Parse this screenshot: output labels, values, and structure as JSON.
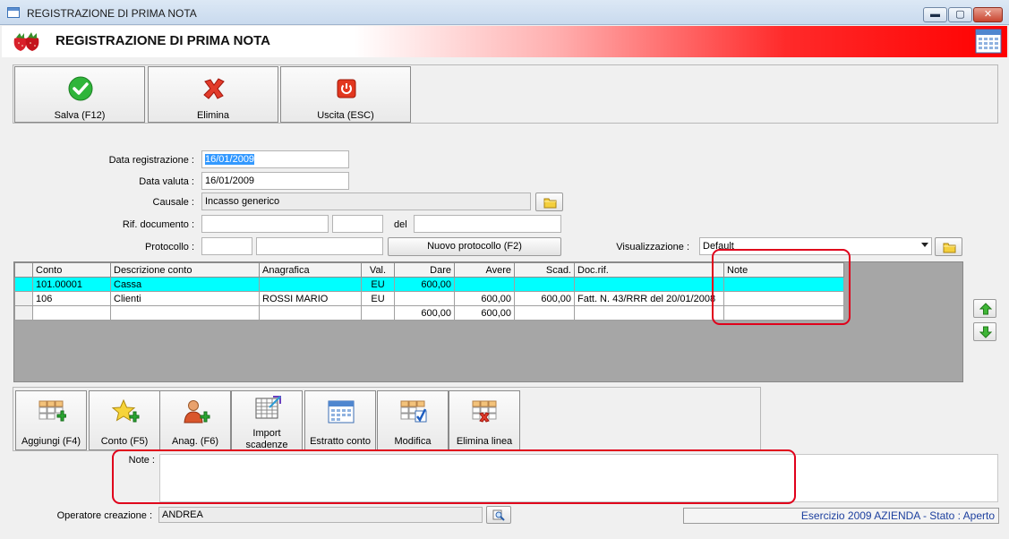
{
  "window": {
    "title": "REGISTRAZIONE DI PRIMA NOTA",
    "minimize": "▬",
    "maximize": "▢",
    "close": "✕"
  },
  "banner": {
    "title": "REGISTRAZIONE DI PRIMA NOTA"
  },
  "toolbar": {
    "save": "Salva (F12)",
    "delete": "Elimina",
    "exit": "Uscita (ESC)"
  },
  "form": {
    "data_registrazione_label": "Data registrazione :",
    "data_registrazione": "16/01/2009",
    "data_valuta_label": "Data valuta :",
    "data_valuta": "16/01/2009",
    "causale_label": "Causale :",
    "causale": "Incasso generico",
    "rif_documento_label": "Rif. documento :",
    "rif_documento_1": "",
    "rif_documento_2": "",
    "del_label": "del",
    "del": "",
    "protocollo_label": "Protocollo :",
    "protocollo_1": "",
    "protocollo_2": "",
    "nuovo_protocollo": "Nuovo protocollo (F2)",
    "visualizzazione_label": "Visualizzazione :",
    "visualizzazione": "Default"
  },
  "grid": {
    "columns": [
      "Conto",
      "Descrizione conto",
      "Anagrafica",
      "Val.",
      "Dare",
      "Avere",
      "Scad.",
      "Doc.rif.",
      "Note"
    ],
    "rows": [
      {
        "conto": "101.00001",
        "descrizione": "Cassa",
        "anagrafica": "",
        "val": "EU",
        "dare": "600,00",
        "avere": "",
        "scad": "",
        "docrif": "",
        "note": ""
      },
      {
        "conto": "106",
        "descrizione": "Clienti",
        "anagrafica": "ROSSI MARIO",
        "val": "EU",
        "dare": "",
        "avere": "600,00",
        "scad": "600,00",
        "docrif": "Fatt. N. 43/RRR del 20/01/2008",
        "note": ""
      }
    ],
    "totals": {
      "dare": "600,00",
      "avere": "600,00"
    }
  },
  "actions": {
    "aggiungi": "Aggiungi (F4)",
    "conto": "Conto (F5)",
    "anag": "Anag. (F6)",
    "import_line1": "Import",
    "import_line2": "scadenze",
    "estratto": "Estratto conto",
    "modifica": "Modifica",
    "elimina_linea": "Elimina linea"
  },
  "notes": {
    "label": "Note :",
    "value": ""
  },
  "footer": {
    "operatore_label": "Operatore creazione :",
    "operatore": "ANDREA",
    "status": "Esercizio 2009 AZIENDA - Stato : Aperto"
  },
  "colors": {
    "selected_row": "#00ffff",
    "highlight_box": "#e0001b",
    "status_text": "#1c3f9e"
  }
}
